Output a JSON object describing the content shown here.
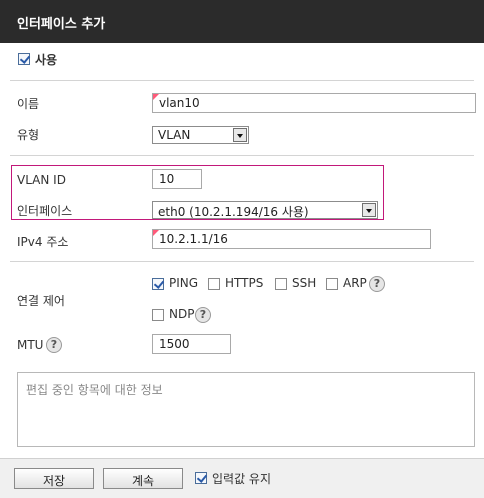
{
  "dialog": {
    "title": "인터페이스 추가"
  },
  "enable": {
    "label": "사용",
    "checked": true
  },
  "fields": {
    "name": {
      "label": "이름",
      "value": "vlan10"
    },
    "type": {
      "label": "유형",
      "selected": "VLAN"
    },
    "vlan_id": {
      "label": "VLAN ID",
      "value": "10"
    },
    "interface": {
      "label": "인터페이스",
      "selected": "eth0 (10.2.1.194/16 사용)"
    },
    "ipv4": {
      "label": "IPv4 주소",
      "value": "10.2.1.1/16"
    },
    "connection_control": {
      "label": "연결 제어",
      "options": [
        {
          "label": "PING",
          "checked": true
        },
        {
          "label": "HTTPS",
          "checked": false
        },
        {
          "label": "SSH",
          "checked": false
        },
        {
          "label": "ARP",
          "checked": false
        },
        {
          "label": "NDP",
          "checked": false
        }
      ]
    },
    "mtu": {
      "label": "MTU",
      "value": "1500"
    }
  },
  "info_placeholder": "편집 중인 항목에 대한 정보",
  "footer": {
    "save_label": "저장",
    "continue_label": "계속",
    "keep_input_label": "입력값 유지",
    "keep_input_checked": true
  },
  "icons": {
    "help": "?"
  },
  "colors": {
    "titlebar": "#2b2b2b",
    "highlight_border": "#c2187a",
    "required_marker": "#ff5a7a"
  }
}
